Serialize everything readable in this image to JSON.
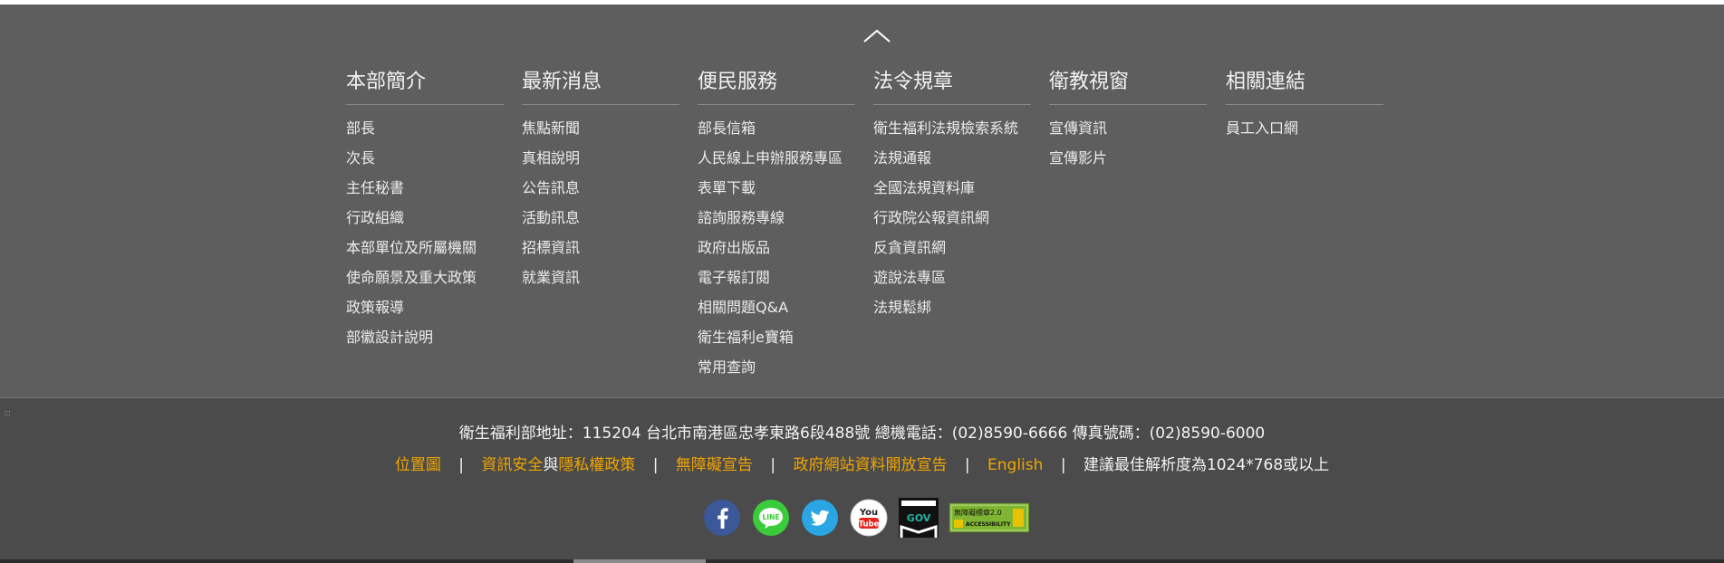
{
  "sitemap": {
    "columns": [
      {
        "title": "本部簡介",
        "items": [
          "部長",
          "次長",
          "主任秘書",
          "行政組織",
          "本部單位及所屬機關",
          "使命願景及重大政策",
          "政策報導",
          "部徽設計說明"
        ]
      },
      {
        "title": "最新消息",
        "items": [
          "焦點新聞",
          "真相說明",
          "公告訊息",
          "活動訊息",
          "招標資訊",
          "就業資訊"
        ]
      },
      {
        "title": "便民服務",
        "items": [
          "部長信箱",
          "人民線上申辦服務專區",
          "表單下載",
          "諮詢服務專線",
          "政府出版品",
          "電子報訂閱",
          "相關問題Q&A",
          "衛生福利e寶箱",
          "常用查詢"
        ]
      },
      {
        "title": "法令規章",
        "items": [
          "衛生福利法規檢索系統",
          "法規通報",
          "全國法規資料庫",
          "行政院公報資訊網",
          "反貪資訊網",
          "遊說法專區",
          "法規鬆綁"
        ]
      },
      {
        "title": "衛教視窗",
        "items": [
          "宣傳資訊",
          "宣傳影片"
        ]
      },
      {
        "title": "相關連結",
        "items": [
          "員工入口網"
        ]
      }
    ]
  },
  "footer": {
    "address": "衛生福利部地址：115204 台北市南港區忠孝東路6段488號 總機電話：(02)8590-6666 傳真號碼：(02)8590-6000",
    "links": {
      "sitemap": "位置圖",
      "info_security": "資訊安全",
      "and": "與",
      "privacy": "隱私權政策",
      "accessibility": "無障礙宣告",
      "open_data": "政府網站資料開放宣告",
      "english": "English",
      "resolution": "建議最佳解析度為1024*768或以上"
    },
    "separator": "|",
    "social": {
      "line_text": "LINE",
      "youtube_you": "You",
      "youtube_tube": "Tube",
      "gov_text": "GOV",
      "accessibility_badge": "無障礙標章2.0",
      "accessibility_sub": "ACCESSIBILITY"
    }
  },
  "colors": {
    "top_bg": "#5e5e5e",
    "bottom_bg": "#4b4b4b",
    "link_accent": "#f0a500",
    "facebook": "#3b5998",
    "line": "#3acc3a",
    "twitter": "#29a6e3",
    "youtube": "#e0261f"
  },
  "icons": [
    "chevron-up-icon",
    "facebook-icon",
    "line-icon",
    "twitter-icon",
    "youtube-icon",
    "gov-icon",
    "accessibility-badge-icon"
  ]
}
